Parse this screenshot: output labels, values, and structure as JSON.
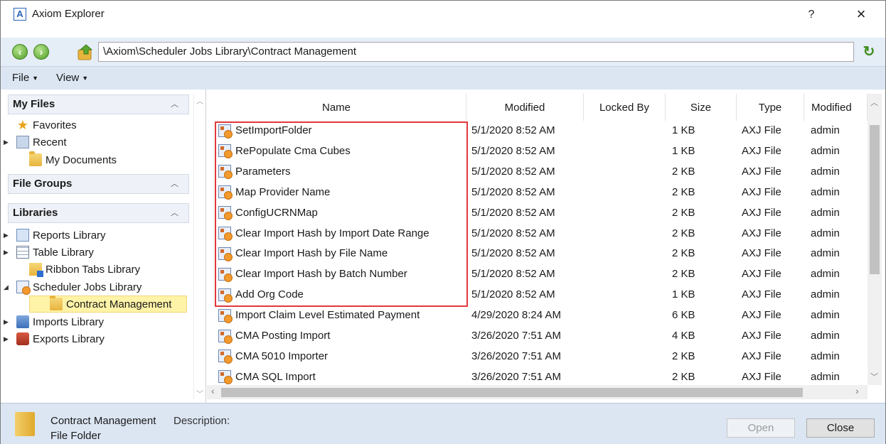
{
  "window": {
    "app_icon_letter": "A",
    "title": "Axiom Explorer",
    "help_label": "?",
    "close_label": "×"
  },
  "address": {
    "path": "\\Axiom\\Scheduler Jobs Library\\Contract Management"
  },
  "menu": {
    "file": "File",
    "view": "View"
  },
  "sidebar": {
    "my_files": {
      "header": "My Files",
      "items": [
        {
          "label": "Favorites",
          "icon": "star-icon",
          "expander": ""
        },
        {
          "label": "Recent",
          "icon": "recent-icon",
          "expander": "▶"
        },
        {
          "label": "My Documents",
          "icon": "folder-icon",
          "expander": ""
        }
      ]
    },
    "file_groups": {
      "header": "File Groups"
    },
    "libraries": {
      "header": "Libraries",
      "items": [
        {
          "label": "Reports Library",
          "icon": "report-icon",
          "expander": "▶"
        },
        {
          "label": "Table Library",
          "icon": "table-icon",
          "expander": "▶"
        },
        {
          "label": "Ribbon Tabs Library",
          "icon": "ribbon-icon",
          "expander": ""
        },
        {
          "label": "Scheduler Jobs Library",
          "icon": "scheduler-icon",
          "expander": "◢"
        },
        {
          "label": "Contract Management",
          "icon": "folder-icon",
          "expander": ""
        },
        {
          "label": "Imports Library",
          "icon": "imports-icon",
          "expander": "▶"
        },
        {
          "label": "Exports Library",
          "icon": "exports-icon",
          "expander": "▶"
        }
      ]
    }
  },
  "file_list": {
    "columns": [
      "Name",
      "Modified",
      "Locked By",
      "Size",
      "Type",
      "Modified"
    ],
    "rows": [
      {
        "name": "SetImportFolder",
        "modified": "5/1/2020 8:52 AM",
        "locked_by": "",
        "size": "1 KB",
        "type": "AXJ File",
        "modified_by": "admin"
      },
      {
        "name": "RePopulate Cma Cubes",
        "modified": "5/1/2020 8:52 AM",
        "locked_by": "",
        "size": "1 KB",
        "type": "AXJ File",
        "modified_by": "admin"
      },
      {
        "name": "Parameters",
        "modified": "5/1/2020 8:52 AM",
        "locked_by": "",
        "size": "2 KB",
        "type": "AXJ File",
        "modified_by": "admin"
      },
      {
        "name": "Map Provider Name",
        "modified": "5/1/2020 8:52 AM",
        "locked_by": "",
        "size": "2 KB",
        "type": "AXJ File",
        "modified_by": "admin"
      },
      {
        "name": "ConfigUCRNMap",
        "modified": "5/1/2020 8:52 AM",
        "locked_by": "",
        "size": "2 KB",
        "type": "AXJ File",
        "modified_by": "admin"
      },
      {
        "name": "Clear Import Hash by Import Date Range",
        "modified": "5/1/2020 8:52 AM",
        "locked_by": "",
        "size": "2 KB",
        "type": "AXJ File",
        "modified_by": "admin"
      },
      {
        "name": "Clear Import Hash by File Name",
        "modified": "5/1/2020 8:52 AM",
        "locked_by": "",
        "size": "2 KB",
        "type": "AXJ File",
        "modified_by": "admin"
      },
      {
        "name": "Clear Import Hash by Batch Number",
        "modified": "5/1/2020 8:52 AM",
        "locked_by": "",
        "size": "2 KB",
        "type": "AXJ File",
        "modified_by": "admin"
      },
      {
        "name": "Add Org Code",
        "modified": "5/1/2020 8:52 AM",
        "locked_by": "",
        "size": "1 KB",
        "type": "AXJ File",
        "modified_by": "admin"
      },
      {
        "name": "Import Claim Level Estimated Payment",
        "modified": "4/29/2020 8:24 AM",
        "locked_by": "",
        "size": "6 KB",
        "type": "AXJ File",
        "modified_by": "admin"
      },
      {
        "name": "CMA Posting Import",
        "modified": "3/26/2020 7:51 AM",
        "locked_by": "",
        "size": "4 KB",
        "type": "AXJ File",
        "modified_by": "admin"
      },
      {
        "name": "CMA 5010 Importer",
        "modified": "3/26/2020 7:51 AM",
        "locked_by": "",
        "size": "2 KB",
        "type": "AXJ File",
        "modified_by": "admin"
      },
      {
        "name": "CMA SQL Import",
        "modified": "3/26/2020 7:51 AM",
        "locked_by": "",
        "size": "2 KB",
        "type": "AXJ File",
        "modified_by": "admin"
      }
    ],
    "highlight_color": "#e0383e"
  },
  "status": {
    "selected_name": "Contract Management",
    "selected_type": "File Folder",
    "description_label": "Description:",
    "open_button": "Open",
    "close_button": "Close"
  },
  "colors": {
    "toolbar_bg": "#e5edf7",
    "menubar_bg": "#dce6f3",
    "selected_bg": "#fff3a8"
  }
}
